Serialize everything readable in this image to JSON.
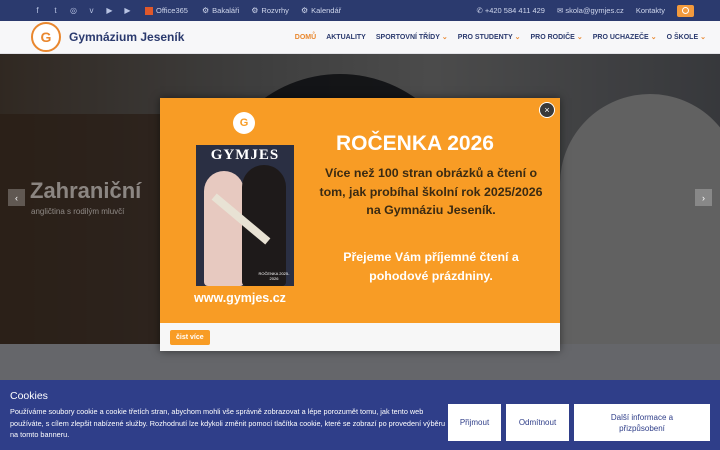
{
  "topbar": {
    "social_icons": [
      "facebook-icon",
      "twitter-icon",
      "instagram-icon",
      "vimeo-icon",
      "youtube-icon",
      "youtube-icon"
    ],
    "office_label": "Office365",
    "links": [
      "Bakaláři",
      "Rozvrhy",
      "Kalendář"
    ],
    "phone": "+420 584 411 429",
    "email": "skola@gymjes.cz",
    "contacts": "Kontakty"
  },
  "nav": {
    "brand": "Gymnázium Jeseník",
    "logo_glyph": "G",
    "items": [
      {
        "label": "DOMŮ",
        "caret": ""
      },
      {
        "label": "AKTUALITY",
        "caret": ""
      },
      {
        "label": "SPORTOVNÍ TŘÍDY",
        "caret": "⌄"
      },
      {
        "label": "PRO STUDENTY",
        "caret": "⌄"
      },
      {
        "label": "PRO RODIČE",
        "caret": "⌄"
      },
      {
        "label": "PRO UCHAZEČE",
        "caret": "⌄"
      },
      {
        "label": "O ŠKOLE",
        "caret": "⌄"
      }
    ]
  },
  "hero": {
    "title": "Zahraniční",
    "subtitle": "angličtina s rodilým mluvčí",
    "prev": "‹",
    "next": "›"
  },
  "modal": {
    "close": "×",
    "logo_glyph": "G",
    "cover_title": "GYMJES",
    "cover_footer": "ROČENKA 2025-2026",
    "url": "www.gymjes.cz",
    "title": "ROČENKA 2026",
    "body": "Více než 100 stran obrázků a čtení o tom, jak probíhal školní rok 2025/2026 na Gymnáziu Jeseník.",
    "wish": "Přejeme Vám příjemné čtení a pohodové prázdniny.",
    "read_more": "čist více"
  },
  "cookie": {
    "title": "Cookies",
    "text": "Používáme soubory cookie a cookie třetích stran, abychom mohli vše správně zobrazovat a lépe porozumět tomu, jak tento web používáte, s cílem zlepšit nabízené služby. Rozhodnutí lze kdykoli změnit pomocí tlačítka cookie, které se zobrazí po provedení výběru na tomto banneru.",
    "accept": "Přijmout",
    "reject": "Odmítnout",
    "more": "Další informace a přizpůsobení"
  },
  "colors": {
    "navy": "#2b3a6e",
    "orange": "#f89c25",
    "cookie_bg": "#2f3e89"
  }
}
